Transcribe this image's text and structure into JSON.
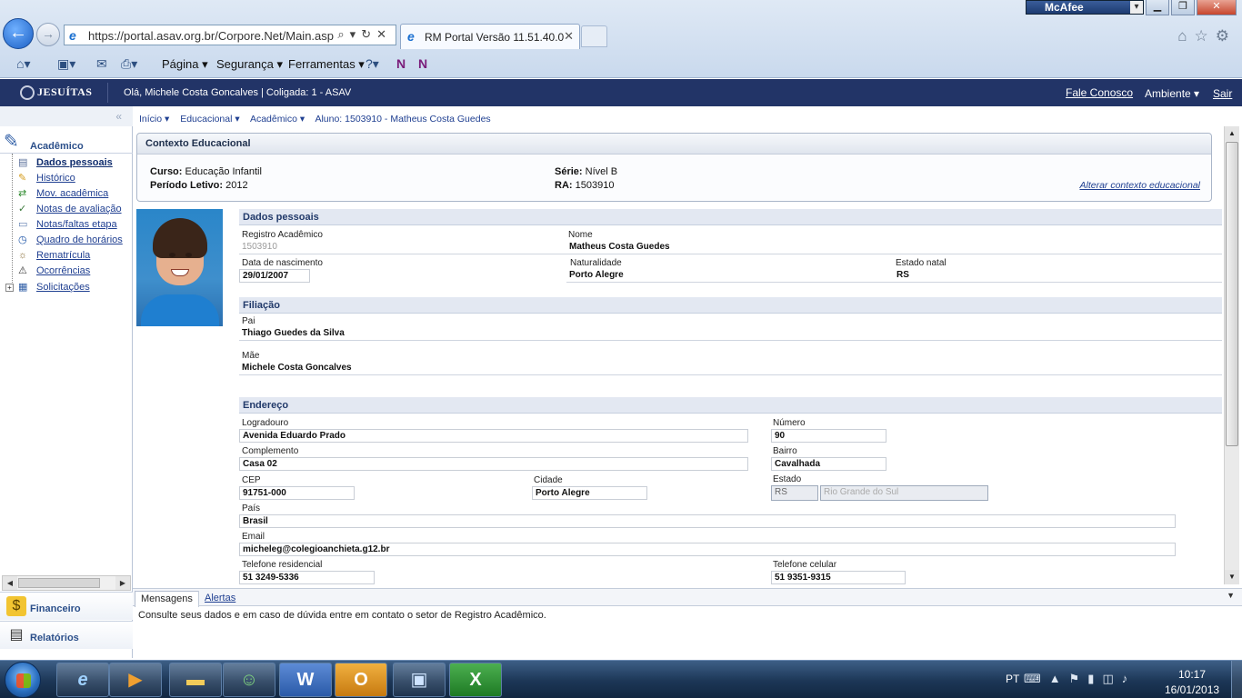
{
  "browser": {
    "url": "https://portal.asav.org.br/Corpore.Net/Main.aspx?S",
    "tab_title": "RM Portal Versão 11.51.40.0",
    "mcafee_label": "McAfee",
    "commands": [
      "Página ▾",
      "Segurança ▾",
      "Ferramentas ▾"
    ]
  },
  "header": {
    "logo": "JESUÍTAS",
    "greeting": "Olá, Michele Costa Goncalves  |  Coligada: 1 - ASAV",
    "contact": "Fale Conosco",
    "environment": "Ambiente ▾",
    "logout": "Sair"
  },
  "sidebar": {
    "section_title": "Acadêmico",
    "items": [
      {
        "label": "Dados pessoais",
        "icon": "person-card-icon"
      },
      {
        "label": "Histórico",
        "icon": "pencil-icon"
      },
      {
        "label": "Mov. acadêmica",
        "icon": "arrows-icon"
      },
      {
        "label": "Notas de avaliação",
        "icon": "grades-icon"
      },
      {
        "label": "Notas/faltas etapa",
        "icon": "document-icon"
      },
      {
        "label": "Quadro de horários",
        "icon": "clock-icon"
      },
      {
        "label": "Rematrícula",
        "icon": "swirl-icon"
      },
      {
        "label": "Ocorrências",
        "icon": "warning-icon"
      },
      {
        "label": "Solicitações",
        "icon": "request-icon"
      }
    ],
    "financeiro": "Financeiro",
    "relatorios": "Relatórios"
  },
  "breadcrumb": [
    "Início ▾",
    "Educacional ▾",
    "Acadêmico ▾",
    "Aluno: 1503910 - Matheus Costa Guedes"
  ],
  "context": {
    "title": "Contexto Educacional",
    "curso_label": "Curso:",
    "curso": "Educação Infantil",
    "periodo_label": "Período Letivo:",
    "periodo": "2012",
    "serie_label": "Série:",
    "serie": "Nível B",
    "ra_label": "RA:",
    "ra": "1503910",
    "change_link": "Alterar contexto educacional"
  },
  "personal": {
    "title": "Dados pessoais",
    "registro_label": "Registro Acadêmico",
    "registro": "1503910",
    "nome_label": "Nome",
    "nome": "Matheus Costa Guedes",
    "nascimento_label": "Data de nascimento",
    "nascimento": "29/01/2007",
    "naturalidade_label": "Naturalidade",
    "naturalidade": "Porto Alegre",
    "estado_natal_label": "Estado natal",
    "estado_natal": "RS"
  },
  "filiacao": {
    "title": "Filiação",
    "pai_label": "Pai",
    "pai": "Thiago Guedes da Silva",
    "mae_label": "Mãe",
    "mae": "Michele Costa Goncalves"
  },
  "endereco": {
    "title": "Endereço",
    "logradouro_label": "Logradouro",
    "logradouro": "Avenida Eduardo Prado",
    "numero_label": "Número",
    "numero": "90",
    "complemento_label": "Complemento",
    "complemento": "Casa 02",
    "bairro_label": "Bairro",
    "bairro": "Cavalhada",
    "cep_label": "CEP",
    "cep": "91751-000",
    "cidade_label": "Cidade",
    "cidade": "Porto Alegre",
    "estado_label": "Estado",
    "estado_uf": "RS",
    "estado_nome": "Rio Grande do Sul",
    "pais_label": "País",
    "pais": "Brasil",
    "email_label": "Email",
    "email": "micheleg@colegioanchieta.g12.br",
    "tel_res_label": "Telefone residencial",
    "tel_res": "51 3249-5336",
    "tel_cel_label": "Telefone celular",
    "tel_cel": "51 9351-9315"
  },
  "messages": {
    "tab_messages": "Mensagens",
    "tab_alerts": "Alertas",
    "text": "Consulte seus dados e em caso de dúvida entre em contato o setor de Registro Acadêmico."
  },
  "taskbar": {
    "language": "PT",
    "time": "10:17",
    "date": "16/01/2013"
  }
}
